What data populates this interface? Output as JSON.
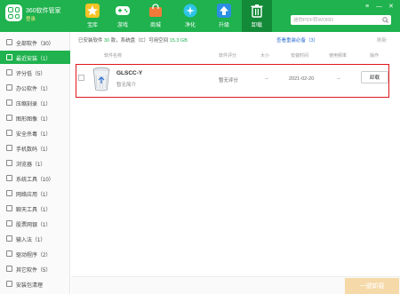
{
  "app": {
    "name": "360软件管家",
    "login": "登录"
  },
  "tabs": [
    {
      "label": "宝库",
      "icon": "star-icon"
    },
    {
      "label": "游戏",
      "icon": "gamepad-icon"
    },
    {
      "label": "商城",
      "icon": "shopping-bag-icon"
    },
    {
      "label": "净化",
      "icon": "purify-icon"
    },
    {
      "label": "升级",
      "icon": "upgrade-arrow-icon"
    },
    {
      "label": "卸载",
      "icon": "trash-icon"
    }
  ],
  "search": {
    "placeholder": "迷你PDF转WORD"
  },
  "window_controls": [
    "≡",
    "—",
    "✕"
  ],
  "sidebar": {
    "items": [
      {
        "label": "全部软件（30）"
      },
      {
        "label": "最近安装（1）"
      },
      {
        "label": "评分低（5）"
      },
      {
        "label": "办公软件（1）"
      },
      {
        "label": "压缩刻录（1）"
      },
      {
        "label": "图形图像（1）"
      },
      {
        "label": "安全杀毒（1）"
      },
      {
        "label": "手机数码（1）"
      },
      {
        "label": "浏览器（1）"
      },
      {
        "label": "系统工具（10）"
      },
      {
        "label": "网络应用（1）"
      },
      {
        "label": "聊天工具（1）"
      },
      {
        "label": "股票网银（1）"
      },
      {
        "label": "输入法（1）"
      },
      {
        "label": "驱动程序（2）"
      },
      {
        "label": "其它软件（5）"
      },
      {
        "label": "安装包清理"
      }
    ]
  },
  "stats": {
    "prefix": "已安装软件 ",
    "count": "30",
    "middle": " 款，系统盘（C）可用空间 ",
    "space": "15.3 GB"
  },
  "quickfix": "查看重装必备（3）",
  "refresh": "刷新",
  "table": {
    "headers": [
      "软件名称",
      "软件评分",
      "大小",
      "安装时间",
      "使用频率",
      "操作"
    ],
    "rows": [
      {
        "name": "GLSCC-Y",
        "desc": "暂无简介",
        "rating": "暂无评分",
        "size": "--",
        "install_date": "2021-02-20",
        "frequency": "--",
        "action": "卸载"
      }
    ]
  },
  "footer": {
    "one_key_uninstall": "一键卸载"
  },
  "colors": {
    "brand_green": "#1fb24e",
    "highlight_red": "#e0161c",
    "link_blue": "#2b6ccf"
  }
}
